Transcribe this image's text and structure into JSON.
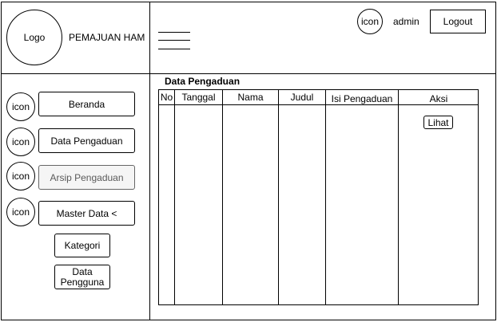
{
  "header": {
    "logo_label": "Logo",
    "app_title": "PEMAJUAN HAM",
    "user_icon_label": "icon",
    "username": "admin",
    "logout_label": "Logout"
  },
  "sidebar": {
    "items": [
      {
        "icon_label": "icon",
        "label": "Beranda"
      },
      {
        "icon_label": "icon",
        "label": "Data Pengaduan"
      },
      {
        "icon_label": "icon",
        "label": "Arsip Pengaduan"
      },
      {
        "icon_label": "icon",
        "label": "Master Data <"
      }
    ],
    "submenu": [
      {
        "label": "Kategori"
      },
      {
        "label": "Data Pengguna"
      }
    ]
  },
  "main": {
    "title": "Data Pengaduan",
    "table": {
      "columns": [
        "No",
        "Tanggal",
        "Nama",
        "Judul",
        "Isi Pengaduan",
        "Aksi"
      ],
      "action_button_label": "Lihat"
    }
  }
}
